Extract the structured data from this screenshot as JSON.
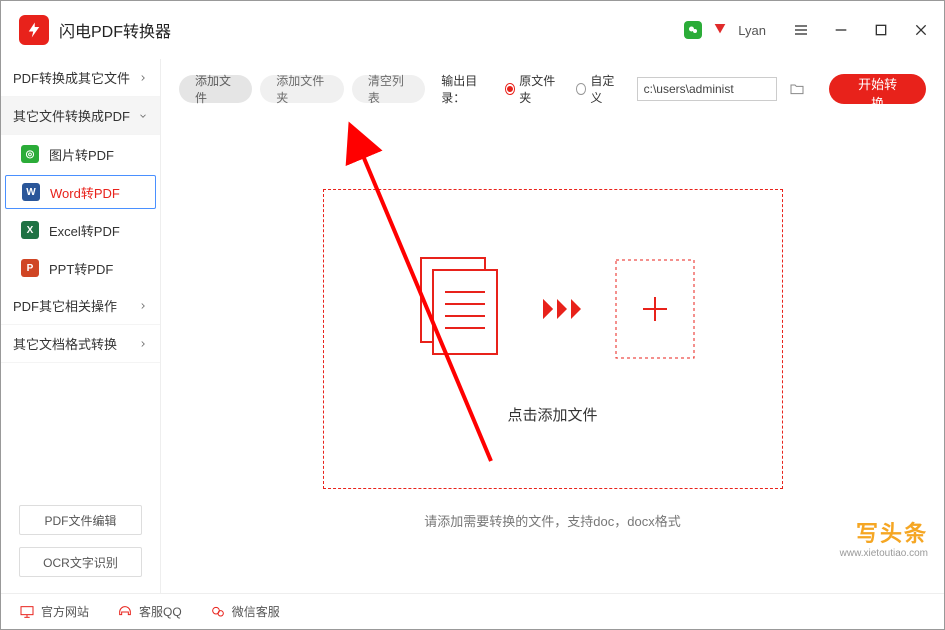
{
  "app": {
    "title": "闪电PDF转换器"
  },
  "titlebar": {
    "username": "Lyan"
  },
  "sidebar": {
    "cat_pdf_to_other": "PDF转换成其它文件",
    "cat_other_to_pdf": "其它文件转换成PDF",
    "sub_img": "图片转PDF",
    "sub_word": "Word转PDF",
    "sub_excel": "Excel转PDF",
    "sub_ppt": "PPT转PDF",
    "cat_pdf_ops": "PDF其它相关操作",
    "cat_doc_convert": "其它文档格式转换",
    "btn_pdf_edit": "PDF文件编辑",
    "btn_ocr": "OCR文字识别"
  },
  "toolbar": {
    "add_file": "添加文件",
    "add_folder": "添加文件夹",
    "clear_list": "清空列表",
    "out_label": "输出目录：",
    "radio_src": "原文件夹",
    "radio_custom": "自定义",
    "path": "c:\\users\\administ",
    "start": "开始转换"
  },
  "dropzone": {
    "click_text": "点击添加文件",
    "hint": "请添加需要转换的文件，支持doc，docx格式"
  },
  "footer": {
    "site": "官方网站",
    "qq": "客服QQ",
    "wechat": "微信客服"
  },
  "watermark": {
    "line1": "写头条",
    "line2": "www.xietoutiao.com"
  }
}
